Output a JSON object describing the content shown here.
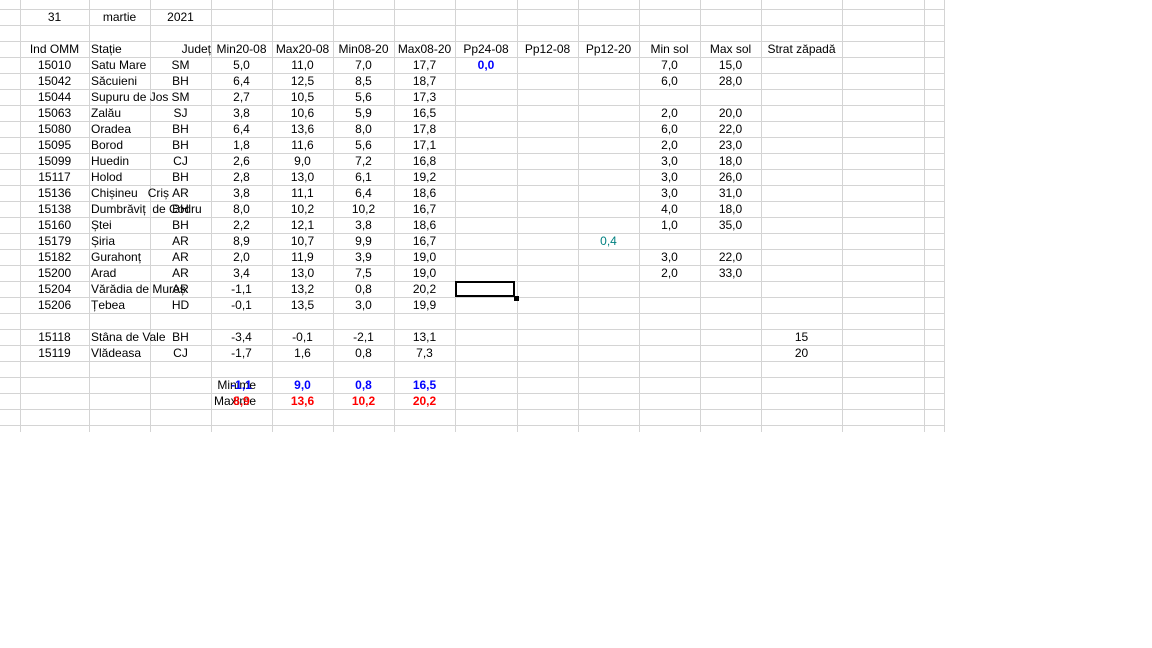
{
  "date": {
    "day": "31",
    "month": "martie",
    "year": "2021"
  },
  "headers": [
    "Ind OMM",
    "Stație",
    "Județ",
    "Min20-08",
    "Max20-08",
    "Min08-20",
    "Max08-20",
    "Pp24-08",
    "Pp12-08",
    "Pp12-20",
    "Min sol",
    "Max sol",
    "Strat zăpadă"
  ],
  "rows": [
    [
      "15010",
      "Satu Mare",
      "SM",
      "5,0",
      "11,0",
      "7,0",
      "17,7",
      "0,0",
      "",
      "",
      "7,0",
      "15,0",
      ""
    ],
    [
      "15042",
      "Săcuieni",
      "BH",
      "6,4",
      "12,5",
      "8,5",
      "18,7",
      "",
      "",
      "",
      "6,0",
      "28,0",
      ""
    ],
    [
      "15044",
      "Supuru de Jos",
      "SM",
      "2,7",
      "10,5",
      "5,6",
      "17,3",
      "",
      "",
      "",
      "",
      "",
      ""
    ],
    [
      "15063",
      "Zalău",
      "SJ",
      "3,8",
      "10,6",
      "5,9",
      "16,5",
      "",
      "",
      "",
      "2,0",
      "20,0",
      ""
    ],
    [
      "15080",
      "Oradea",
      "BH",
      "6,4",
      "13,6",
      "8,0",
      "17,8",
      "",
      "",
      "",
      "6,0",
      "22,0",
      ""
    ],
    [
      "15095",
      "Borod",
      "BH",
      "1,8",
      "11,6",
      "5,6",
      "17,1",
      "",
      "",
      "",
      "2,0",
      "23,0",
      ""
    ],
    [
      "15099",
      "Huedin",
      "CJ",
      "2,6",
      "9,0",
      "7,2",
      "16,8",
      "",
      "",
      "",
      "3,0",
      "18,0",
      ""
    ],
    [
      "15117",
      "Holod",
      "BH",
      "2,8",
      "13,0",
      "6,1",
      "19,2",
      "",
      "",
      "",
      "3,0",
      "26,0",
      ""
    ],
    [
      "15136",
      "Chișineu   Criș",
      "AR",
      "3,8",
      "11,1",
      "6,4",
      "18,6",
      "",
      "",
      "",
      "3,0",
      "31,0",
      ""
    ],
    [
      "15138",
      "Dumbrăviț  de Codru",
      "BH",
      "8,0",
      "10,2",
      "10,2",
      "16,7",
      "",
      "",
      "",
      "4,0",
      "18,0",
      ""
    ],
    [
      "15160",
      "Ștei",
      "BH",
      "2,2",
      "12,1",
      "3,8",
      "18,6",
      "",
      "",
      "",
      "1,0",
      "35,0",
      ""
    ],
    [
      "15179",
      "Șiria",
      "AR",
      "8,9",
      "10,7",
      "9,9",
      "16,7",
      "",
      "",
      "0,4",
      "",
      "",
      ""
    ],
    [
      "15182",
      "Gurahonț",
      "AR",
      "2,0",
      "11,9",
      "3,9",
      "19,0",
      "",
      "",
      "",
      "3,0",
      "22,0",
      ""
    ],
    [
      "15200",
      "Arad",
      "AR",
      "3,4",
      "13,0",
      "7,5",
      "19,0",
      "",
      "",
      "",
      "2,0",
      "33,0",
      ""
    ],
    [
      "15204",
      "Vărădia de Mureș",
      "AR",
      "-1,1",
      "13,2",
      "0,8",
      "20,2",
      "",
      "",
      "",
      "",
      "",
      ""
    ],
    [
      "15206",
      "Țebea",
      "HD",
      "-0,1",
      "13,5",
      "3,0",
      "19,9",
      "",
      "",
      "",
      "",
      "",
      ""
    ]
  ],
  "mountain_rows": [
    [
      "15118",
      "Stâna de Vale",
      "BH",
      "-3,4",
      "-0,1",
      "-2,1",
      "13,1",
      "",
      "",
      "",
      "",
      "",
      "15"
    ],
    [
      "15119",
      "Vlădeasa",
      "CJ",
      "-1,7",
      "1,6",
      "0,8",
      "7,3",
      "",
      "",
      "",
      "",
      "",
      "20"
    ]
  ],
  "summary": {
    "min_label": "Minime",
    "max_label": "Maxime",
    "min_values": [
      "-1,1",
      "9,0",
      "0,8",
      "16,5"
    ],
    "max_values": [
      "8,9",
      "13,6",
      "10,2",
      "20,2"
    ]
  },
  "colors": {
    "min": "#0000ff",
    "max": "#ff0000",
    "pp12_20": "#008080",
    "gridline": "#d4d4d4"
  }
}
